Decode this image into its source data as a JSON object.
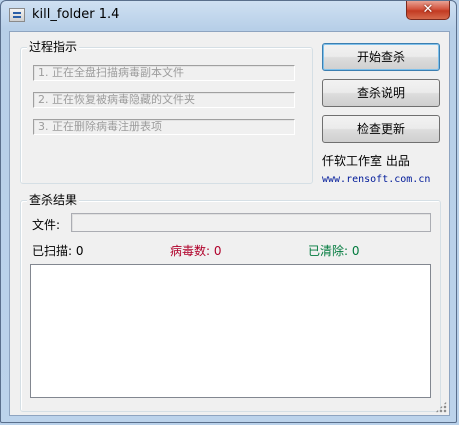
{
  "window": {
    "title": "kill_folder 1.4",
    "close_glyph": "✕"
  },
  "process": {
    "label": "过程指示",
    "steps": [
      "1. 正在全盘扫描病毒副本文件",
      "2. 正在恢复被病毒隐藏的文件夹",
      "3. 正在删除病毒注册表项"
    ]
  },
  "buttons": {
    "start_scan": "开始查杀",
    "help": "查杀说明",
    "check_update": "检查更新"
  },
  "credits": {
    "publisher": "仟软工作室 出品",
    "url": "www.rensoft.com.cn"
  },
  "results": {
    "label": "查杀结果",
    "file_label": "文件:",
    "file_value": "",
    "scanned_label": "已扫描:",
    "scanned_count": "0",
    "virus_label": "病毒数:",
    "virus_count": "0",
    "cleaned_label": "已清除:",
    "cleaned_count": "0"
  },
  "colors": {
    "virus": "#b0002a",
    "cleaned": "#007a3d",
    "url": "#001a99"
  }
}
